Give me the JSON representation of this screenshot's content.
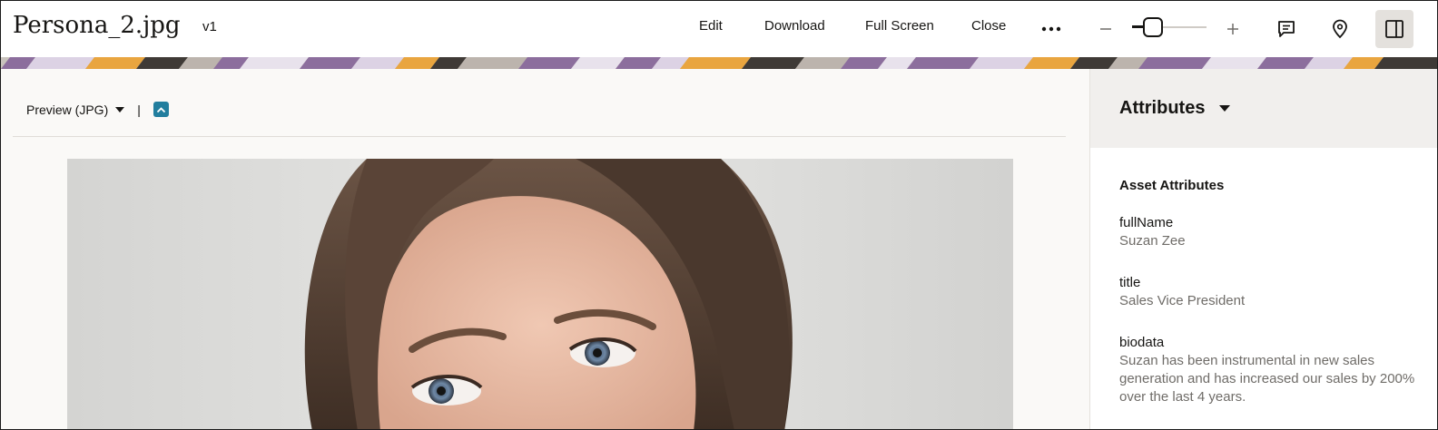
{
  "header": {
    "title": "Persona_2.jpg",
    "version": "v1",
    "actions": {
      "edit": "Edit",
      "download": "Download",
      "full_screen": "Full Screen",
      "close": "Close"
    },
    "zoom_level": 0.2
  },
  "preview": {
    "select_label": "Preview (JPG)",
    "separator": "|"
  },
  "panel": {
    "title": "Attributes",
    "section_title": "Asset Attributes",
    "attributes": [
      {
        "key": "fullName",
        "value": "Suzan Zee"
      },
      {
        "key": "title",
        "value": "Sales Vice President"
      },
      {
        "key": "biodata",
        "value": "Suzan has been instrumental in new sales generation and has increased our sales by 200% over the last 4 years."
      }
    ]
  },
  "colors": {
    "accent": "#227e9e",
    "band_purple": "#8c6e9d",
    "band_orange": "#e9a53f"
  },
  "icons": [
    "more-icon",
    "zoom-out-icon",
    "zoom-in-icon",
    "comments-icon",
    "location-pin-icon",
    "panel-toggle-icon",
    "chevron-up-icon"
  ]
}
